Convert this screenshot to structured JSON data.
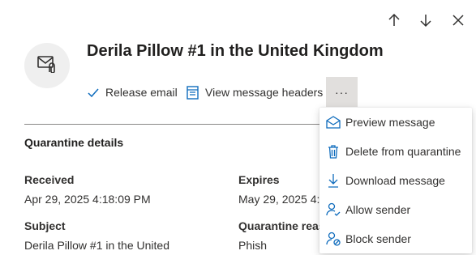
{
  "title": "Derila Pillow #1 in the United Kingdom",
  "actions": {
    "release_label": "Release email",
    "headers_label": "View message headers",
    "more_label": "···"
  },
  "details": {
    "section_title": "Quarantine details",
    "received_label": "Received",
    "received_value": "Apr 29, 2025 4:18:09 PM",
    "expires_label": "Expires",
    "expires_value": "May 29, 2025 4:1",
    "subject_label": "Subject",
    "subject_value": "Derila Pillow #1 in the United",
    "reason_label": "Quarantine reas",
    "reason_value": "Phish"
  },
  "menu": {
    "items": [
      {
        "label": "Preview message",
        "icon": "envelope-open-icon"
      },
      {
        "label": "Delete from quarantine",
        "icon": "trash-icon"
      },
      {
        "label": "Download message",
        "icon": "download-icon"
      },
      {
        "label": "Allow sender",
        "icon": "person-check-icon"
      },
      {
        "label": "Block sender",
        "icon": "person-block-icon"
      }
    ]
  },
  "colors": {
    "accent": "#0f6cbd",
    "text": "#323130",
    "more_button_bg": "#e1dfdd"
  }
}
